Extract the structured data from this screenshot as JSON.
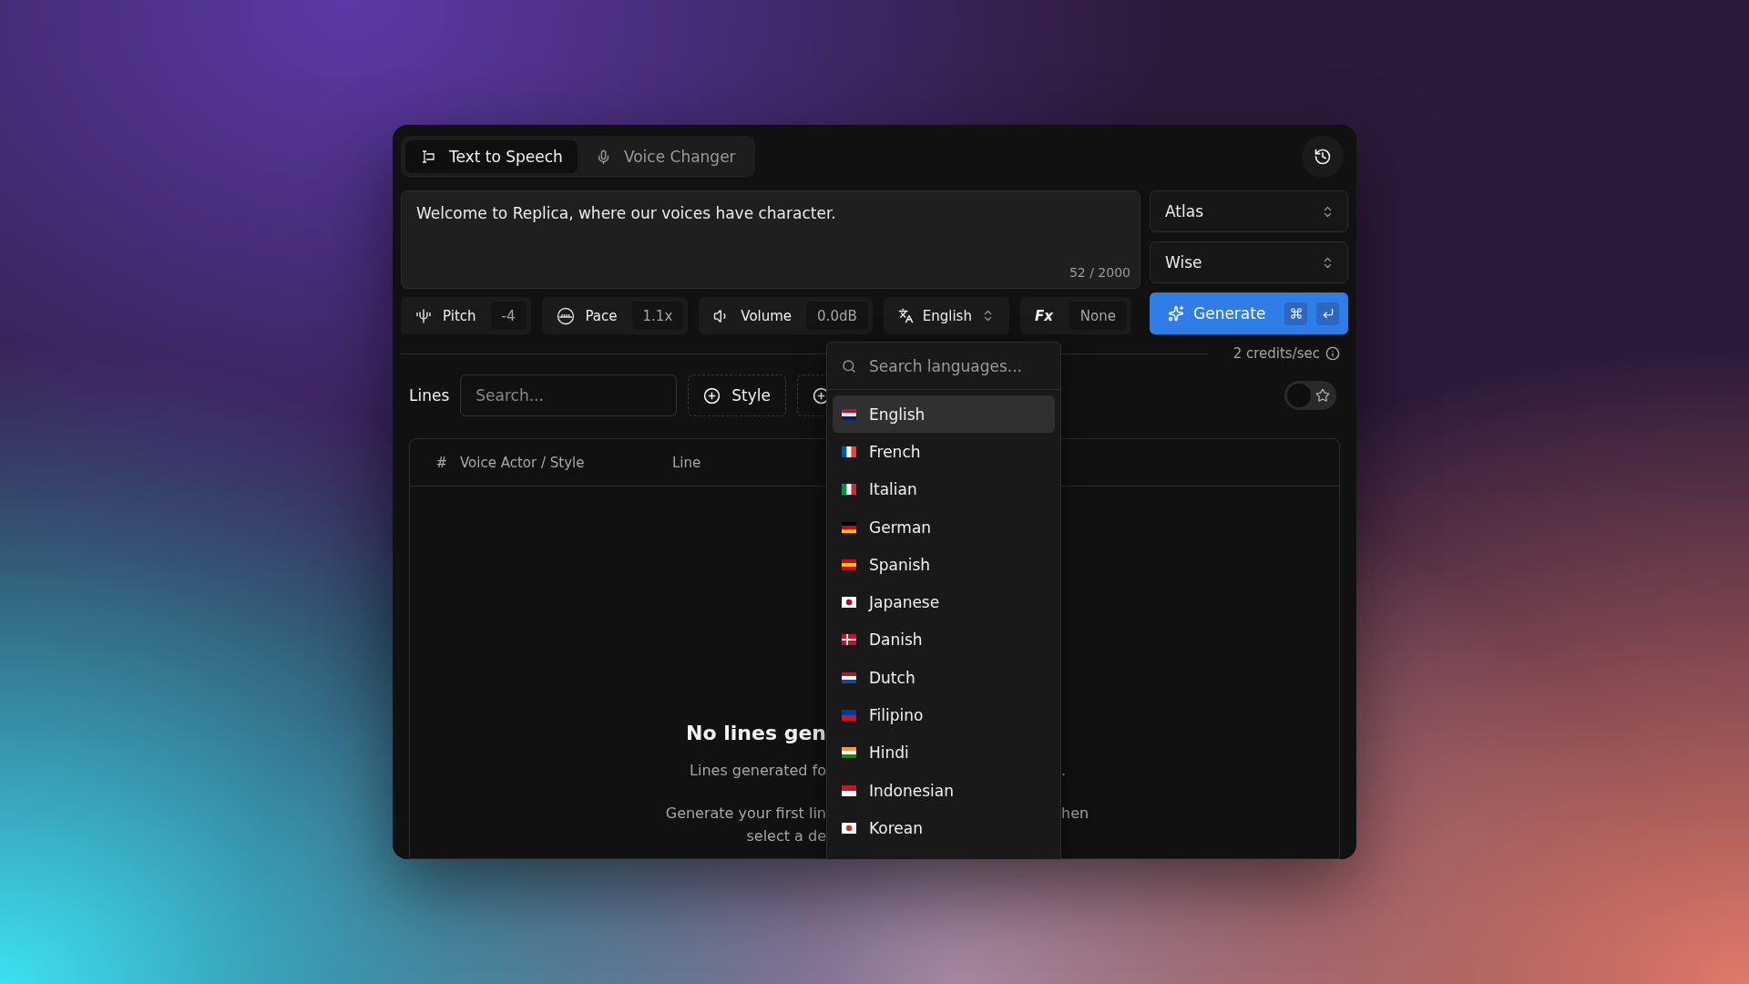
{
  "tabs": [
    {
      "label": "Text to Speech",
      "selected": true
    },
    {
      "label": "Voice Changer",
      "selected": false
    }
  ],
  "script": {
    "value": "Welcome to Replica, where our voices have character.",
    "counter": "52 / 2000"
  },
  "voice_select": {
    "value": "Atlas"
  },
  "style_select": {
    "value": "Wise"
  },
  "controls": [
    {
      "kind": "pitch",
      "label": "Pitch",
      "value": "-4"
    },
    {
      "kind": "pace",
      "label": "Pace",
      "value": "1.1x"
    },
    {
      "kind": "volume",
      "label": "Volume",
      "value": "0.0dB"
    },
    {
      "kind": "language",
      "label": "English"
    },
    {
      "kind": "fx",
      "label": "Fx",
      "value": "None"
    }
  ],
  "generate": {
    "label": "Generate"
  },
  "credits": "2 credits/sec",
  "lines": {
    "title": "Lines",
    "search_placeholder": "Search...",
    "filters": [
      {
        "label": "Style"
      }
    ]
  },
  "favorites_toggle": {
    "on": false
  },
  "table": {
    "columns": [
      "#",
      "Voice Actor / Style",
      "Line"
    ]
  },
  "empty_state": {
    "title": "No lines gen",
    "subtitle": [
      "Lines generated fo",
      "."
    ],
    "hint": [
      "Generate your first lin",
      "hen"
    ],
    "hint_2": "select a de"
  },
  "language_menu": {
    "placeholder": "Search languages...",
    "items": [
      {
        "label": "English",
        "selected": true
      },
      {
        "label": "French",
        "selected": false
      },
      {
        "label": "Italian",
        "selected": false
      },
      {
        "label": "German",
        "selected": false
      },
      {
        "label": "Spanish",
        "selected": false
      },
      {
        "label": "Japanese",
        "selected": false
      },
      {
        "label": "Danish",
        "selected": false
      },
      {
        "label": "Dutch",
        "selected": false
      },
      {
        "label": "Filipino",
        "selected": false
      },
      {
        "label": "Hindi",
        "selected": false
      },
      {
        "label": "Indonesian",
        "selected": false
      },
      {
        "label": "Korean",
        "selected": false
      }
    ]
  }
}
